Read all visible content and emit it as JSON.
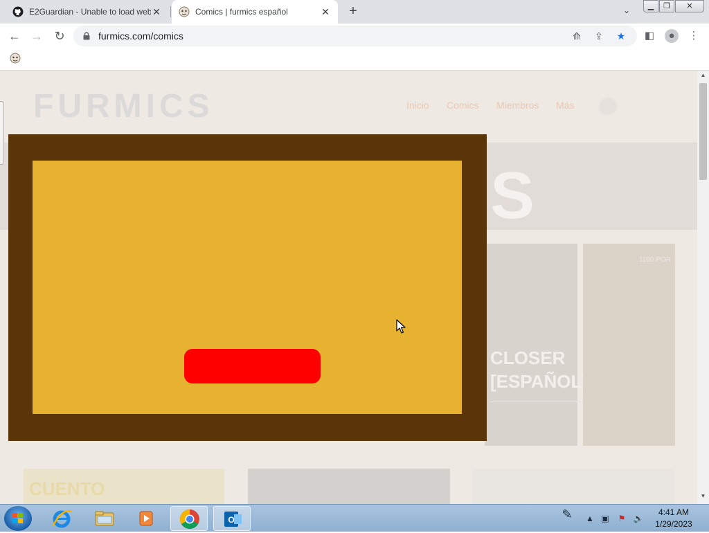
{
  "browser": {
    "tabs": [
      {
        "title": "E2Guardian - Unable to load web",
        "favicon": "github-icon",
        "active": false
      },
      {
        "title": "Comics | furmics español",
        "favicon": "furmics-favicon",
        "active": true
      }
    ],
    "url": "furmics.com/comics"
  },
  "site": {
    "logo": "FURMICS",
    "nav": [
      "Inicio",
      "Comics",
      "Miembros",
      "Más"
    ],
    "hero_letter": "S",
    "card_big_title": "CLOSER [ESPAÑOL]...",
    "card_fox_badge": "1100 POR",
    "row2_label": "CUENTO"
  },
  "modal": {
    "frame_color": "#5a3509",
    "panel_color": "#e7b22f",
    "button_color": "#ff0000"
  },
  "taskbar": {
    "time": "4:41 AM",
    "date": "1/29/2023"
  }
}
